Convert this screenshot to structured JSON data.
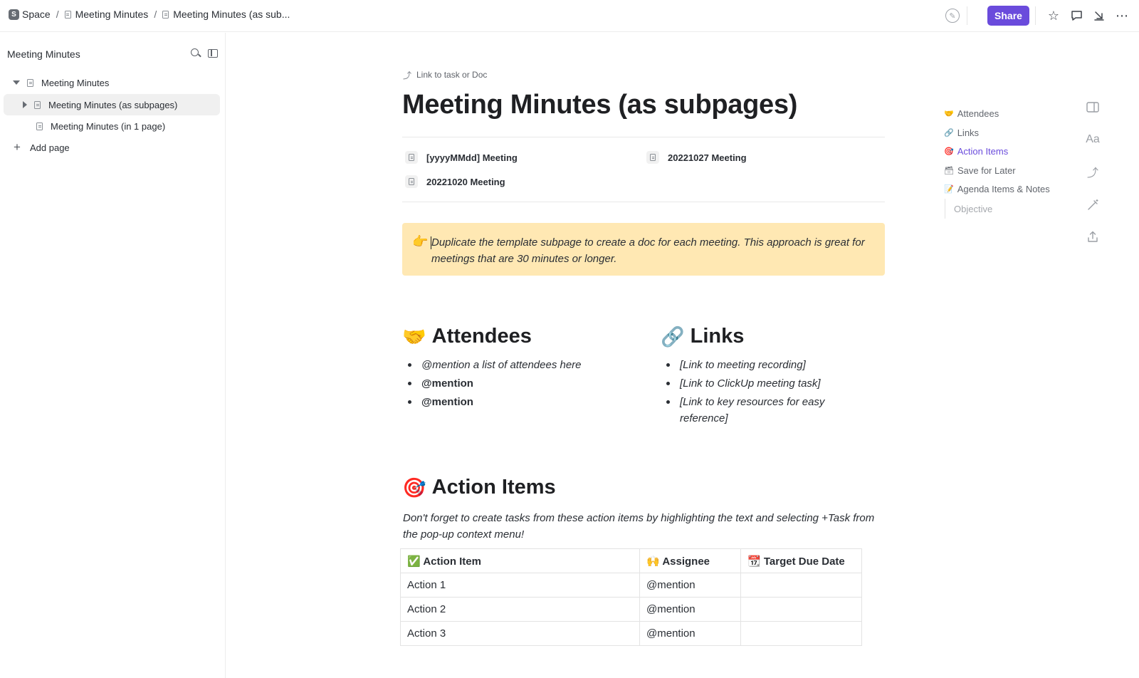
{
  "breadcrumb": {
    "space_badge": "S",
    "space": "Space",
    "separator": "/",
    "parent": "Meeting Minutes",
    "current": "Meeting Minutes (as sub..."
  },
  "topbar": {
    "share_label": "Share",
    "icons": [
      "ai-assistant-icon",
      "star-icon",
      "comment-icon",
      "collapse-icon",
      "more-icon"
    ]
  },
  "sidebar": {
    "title": "Meeting Minutes",
    "tree": [
      {
        "label": "Meeting Minutes",
        "expanded": true
      },
      {
        "label": "Meeting Minutes (as subpages)",
        "active": true
      },
      {
        "label": "Meeting Minutes (in 1 page)"
      }
    ],
    "add_page": "Add page"
  },
  "doc": {
    "link_task": "Link to task or Doc",
    "title": "Meeting Minutes (as subpages)",
    "subpages": [
      "[yyyyMMdd] Meeting",
      "20221027 Meeting",
      "20221020 Meeting"
    ],
    "callout": {
      "emoji": "👉",
      "text": "Duplicate the template subpage to create a doc for each meeting. This approach is great for meetings that are 30 minutes or longer."
    },
    "attendees": {
      "emoji": "🤝",
      "heading": "Attendees",
      "items": [
        "@mention a list of attendees here",
        "@mention",
        "@mention"
      ]
    },
    "links": {
      "emoji": "🔗",
      "heading": "Links",
      "items": [
        "[Link to meeting recording]",
        "[Link to ClickUp meeting task]",
        "[Link to key resources for easy reference]"
      ]
    },
    "action_items": {
      "emoji": "🎯",
      "heading": "Action Items",
      "description": "Don't forget to create tasks from these action items by highlighting the text and selecting +Task from the pop-up context menu!",
      "columns": [
        {
          "emoji": "✅",
          "label": "Action Item"
        },
        {
          "emoji": "🙌",
          "label": "Assignee"
        },
        {
          "emoji": "📆",
          "label": "Target Due Date"
        }
      ],
      "rows": [
        [
          "Action 1",
          "@mention",
          ""
        ],
        [
          "Action 2",
          "@mention",
          ""
        ],
        [
          "Action 3",
          "@mention",
          ""
        ]
      ]
    }
  },
  "toc": {
    "items": [
      {
        "emoji": "🤝",
        "label": "Attendees"
      },
      {
        "emoji": "🔗",
        "label": "Links"
      },
      {
        "emoji": "🎯",
        "label": "Action Items",
        "active": true
      },
      {
        "emoji": "🗃",
        "label": "Save for Later"
      },
      {
        "emoji": "📝",
        "label": "Agenda Items & Notes"
      }
    ],
    "sub_item": "Objective"
  },
  "colors": {
    "accent": "#6a4bdc",
    "callout_bg": "#ffe8b3",
    "active_row": "#f0f0f0"
  }
}
